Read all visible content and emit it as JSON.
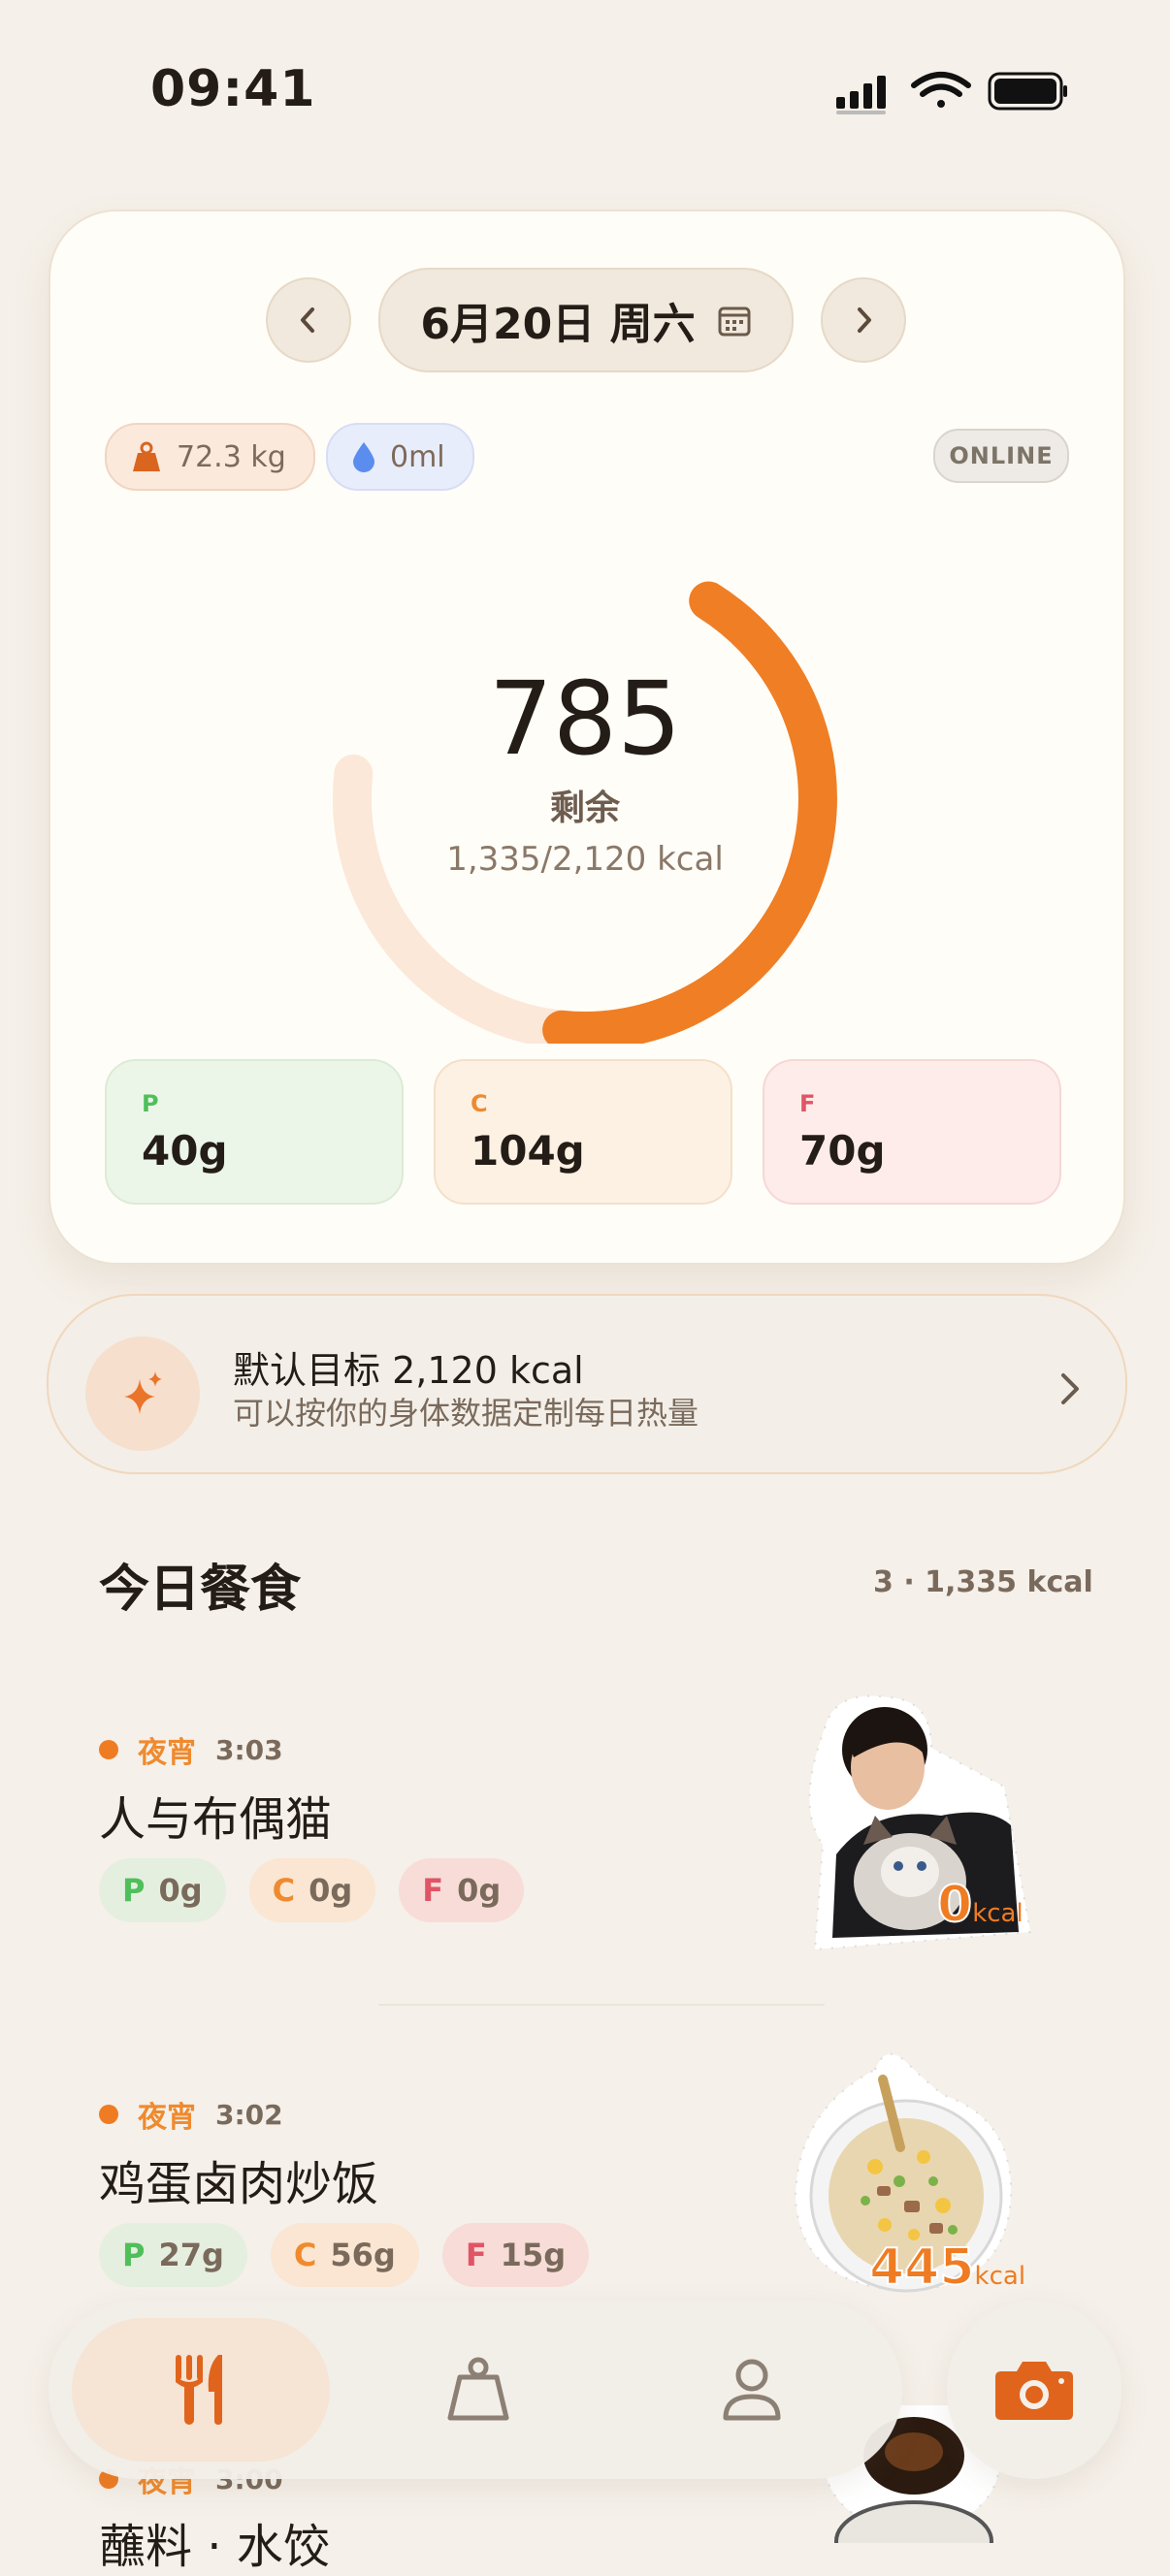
{
  "status": {
    "time": "09:41"
  },
  "date": {
    "label": "6月20日 周六"
  },
  "chips": {
    "weight": "72.3 kg",
    "water": "0ml",
    "online": "ONLINE"
  },
  "ring": {
    "remaining": "785",
    "label": "剩余",
    "sub": "1,335/2,120 kcal",
    "progress": 0.63
  },
  "macros": [
    {
      "key": "P",
      "value": "40g"
    },
    {
      "key": "C",
      "value": "104g"
    },
    {
      "key": "F",
      "value": "70g"
    }
  ],
  "goal": {
    "title": "默认目标 2,120 kcal",
    "subtitle": "可以按你的身体数据定制每日热量"
  },
  "meals_section": {
    "title": "今日餐食",
    "summary": "3 · 1,335 kcal"
  },
  "meals": [
    {
      "category": "夜宵",
      "time": "3:03",
      "name": "人与布偶猫",
      "p": "0g",
      "c": "0g",
      "f": "0g",
      "kcal": "0",
      "kcal_unit": "kcal"
    },
    {
      "category": "夜宵",
      "time": "3:02",
      "name": "鸡蛋卤肉炒饭",
      "p": "27g",
      "c": "56g",
      "f": "15g",
      "kcal": "445",
      "kcal_unit": "kcal"
    },
    {
      "category": "夜宵",
      "time": "3:00",
      "name": "蘸料 · 水饺"
    }
  ],
  "tag_keys": {
    "p": "P",
    "c": "C",
    "f": "F"
  },
  "colors": {
    "accent": "#ef7c22",
    "protein": "#4fbf5a",
    "carbs": "#ef8a2e",
    "fat": "#e05565",
    "background": "#f5f0e9"
  },
  "icons": [
    "signal-icon",
    "wifi-icon",
    "battery-icon",
    "chevron-left-icon",
    "chevron-right-icon",
    "calendar-icon",
    "weight-icon",
    "water-drop-icon",
    "sparkle-icon",
    "fork-knife-icon",
    "scale-icon",
    "person-icon",
    "camera-icon"
  ]
}
